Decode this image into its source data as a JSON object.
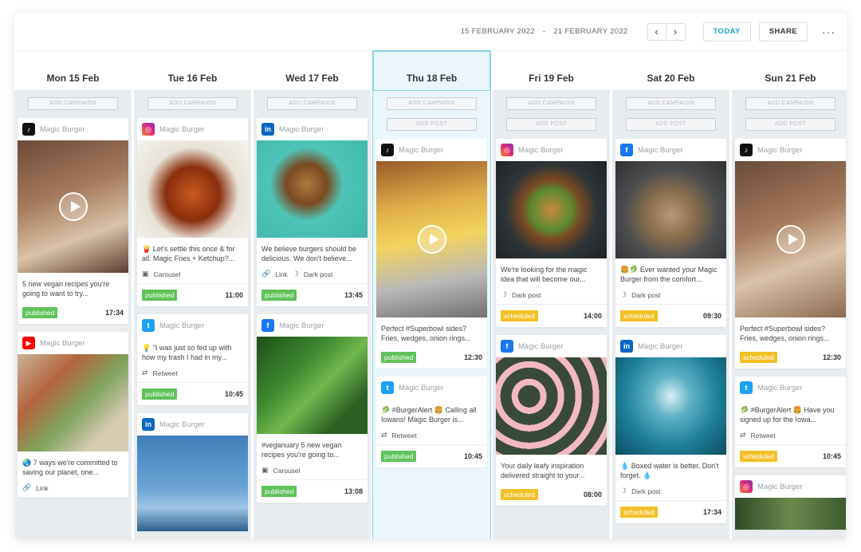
{
  "topbar": {
    "date_from": "15 FEBRUARY 2022",
    "date_sep": "-",
    "date_to": "21 FEBRUARY 2022",
    "prev": "‹",
    "next": "›",
    "today_label": "TODAY",
    "share_label": "SHARE",
    "more": "···"
  },
  "add_campaign": "ADD CAMPAIGN",
  "add_post": "ADD POST",
  "account": "Magic Burger",
  "colors": {
    "accent": "#1aa3c8",
    "published": "#5fc25a",
    "scheduled": "#f2c027"
  },
  "days": [
    {
      "label": "Mon 15 Feb",
      "posts": [
        {
          "network": "tiktok",
          "text": "5 new vegan recipes you're going to want to try...",
          "status": "published",
          "time": "17:34"
        },
        {
          "network": "youtube",
          "text": "🌏 7 ways we're committed to saving our planet, one...",
          "type": "Link",
          "status": "",
          "time": ""
        }
      ]
    },
    {
      "label": "Tue 16 Feb",
      "posts": [
        {
          "network": "instagram",
          "text": "🍟 Let's settle this once & for all: Magic Fries + Ketchup?...",
          "type": "Carousel",
          "status": "published",
          "time": "11:00"
        },
        {
          "network": "twitter",
          "text": "💡 \"I was just so fed up with how my trash I had in my...",
          "type": "Retweet",
          "status": "published",
          "time": "10:45"
        },
        {
          "network": "linkedin",
          "text": "",
          "status": "",
          "time": ""
        }
      ]
    },
    {
      "label": "Wed 17 Feb",
      "posts": [
        {
          "network": "linkedin",
          "text": "We believe burgers should be delicious. We don't believe...",
          "type": "Link",
          "type2": "Dark post",
          "status": "published",
          "time": "13:45"
        },
        {
          "network": "facebook",
          "text": "#veganuary 5 new vegan recipes you're going to...",
          "type": "Carousel",
          "status": "published",
          "time": "13:08"
        }
      ]
    },
    {
      "label": "Thu 18 Feb",
      "posts": [
        {
          "network": "tiktok",
          "text": "Perfect #Superbowl sides? Fries, wedges, onion rings...",
          "status": "published",
          "time": "12:30"
        },
        {
          "network": "twitter",
          "text": "🥬 #BurgerAlert 🍔 Calling all Iowans! Magic Burger is...",
          "type": "Retweet",
          "status": "published",
          "time": "10:45"
        }
      ]
    },
    {
      "label": "Fri 19 Feb",
      "posts": [
        {
          "network": "instagram",
          "text": "We're looking for the magic idea that will become our...",
          "type": "Dark post",
          "status": "scheduled",
          "time": "14:00"
        },
        {
          "network": "facebook",
          "text": "Your daily leafy inspiration delivered straight to your...",
          "status": "scheduled",
          "time": "08:00"
        }
      ]
    },
    {
      "label": "Sat 20 Feb",
      "posts": [
        {
          "network": "facebook",
          "text": "🍔🥬 Ever wanted your Magic Burger from the comfort...",
          "type": "Dark post",
          "status": "scheduled",
          "time": "09:30"
        },
        {
          "network": "linkedin",
          "text": "💧 Boxed water is better. Don't forget. 💧",
          "type": "Dark post",
          "status": "scheduled",
          "time": "17:34"
        }
      ]
    },
    {
      "label": "Sun 21 Feb",
      "posts": [
        {
          "network": "tiktok",
          "text": "Perfect #Superbowl sides? Fries, wedges, onion rings...",
          "status": "scheduled",
          "time": "12:30"
        },
        {
          "network": "twitter",
          "text": "🥬 #BurgerAlert 🍔 Have you signed up for the Iowa...",
          "type": "Retweet",
          "status": "scheduled",
          "time": "10:45"
        },
        {
          "network": "instagram",
          "text": "",
          "status": "",
          "time": ""
        }
      ]
    }
  ]
}
